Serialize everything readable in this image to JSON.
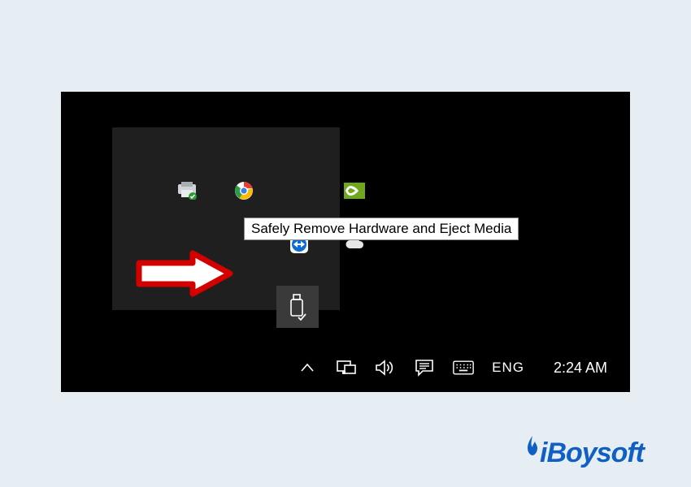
{
  "tooltip_text": "Safely Remove Hardware and Eject Media",
  "taskbar": {
    "language": "ENG",
    "clock": "2:24 AM"
  },
  "tray_icons": {
    "printer": "printer-icon",
    "chrome": "chrome-icon",
    "nvidia": "nvidia-icon",
    "teamviewer": "teamviewer-icon",
    "cloud": "cloud-sync-icon",
    "usb": "safely-remove-hardware-icon"
  },
  "taskbar_icons": {
    "overflow": "show-hidden-icons",
    "network": "network-icon",
    "volume": "volume-icon",
    "action": "action-center-icon",
    "keyboard": "touch-keyboard-icon"
  },
  "brand": "iBoysoft",
  "colors": {
    "page_bg": "#e6edf3",
    "frame_bg": "#000000",
    "popup_bg": "#1f1f1f",
    "highlight_bg": "#3a3a3a",
    "brand": "#0f5fc4",
    "arrow_stroke": "#d40000",
    "arrow_fill": "#ffffff"
  }
}
